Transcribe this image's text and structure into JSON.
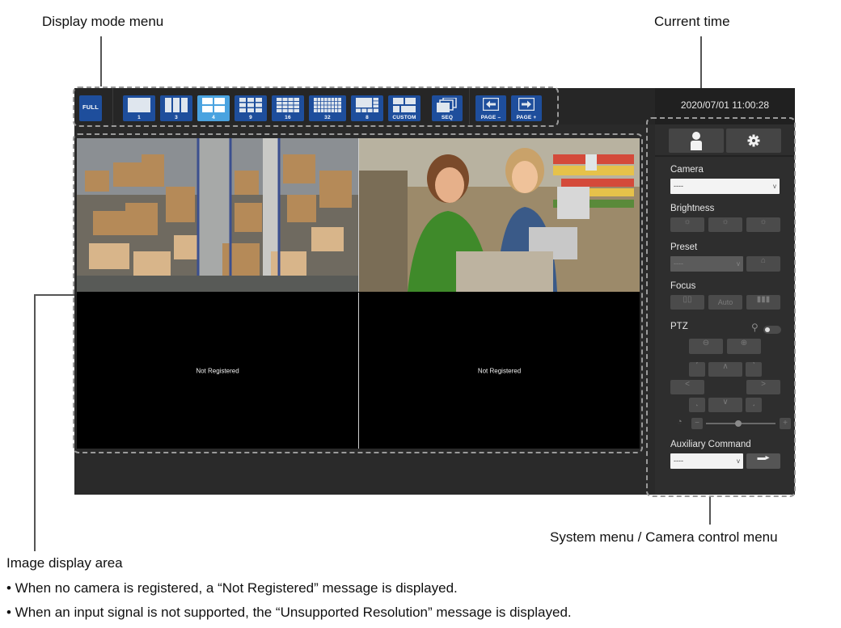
{
  "annotations": {
    "display_mode_menu": "Display mode menu",
    "current_time": "Current time",
    "system_menu": "System menu / Camera control menu",
    "image_display_area": "Image display area",
    "note_not_registered": "• When no camera is registered, a “Not Registered” message is displayed.",
    "note_unsupported": "• When an input signal is not supported, the “Unsupported Resolution” message is displayed."
  },
  "toolbar": {
    "full_label": "FULL",
    "modes": [
      "1",
      "3",
      "4",
      "9",
      "16",
      "32",
      "8",
      "CUSTOM"
    ],
    "active_mode": "4",
    "seq_label": "SEQ",
    "page_minus_label": "PAGE –",
    "page_plus_label": "PAGE +"
  },
  "status": {
    "current_time": "2020/07/01 11:00:28"
  },
  "image_area": {
    "cameras": [
      {
        "content": "warehouse-camera-image"
      },
      {
        "content": "store-checkout-camera-image"
      },
      {
        "message": "Not Registered"
      },
      {
        "message": "Not Registered"
      }
    ]
  },
  "panel": {
    "tabs": [
      "user-icon",
      "gear-icon"
    ],
    "camera_label": "Camera",
    "camera_value": "----",
    "brightness_label": "Brightness",
    "preset_label": "Preset",
    "preset_value": "----",
    "focus_label": "Focus",
    "focus_auto_label": "Auto",
    "ptz_label": "PTZ",
    "aux_label": "Auxiliary Command",
    "aux_value": "----"
  }
}
